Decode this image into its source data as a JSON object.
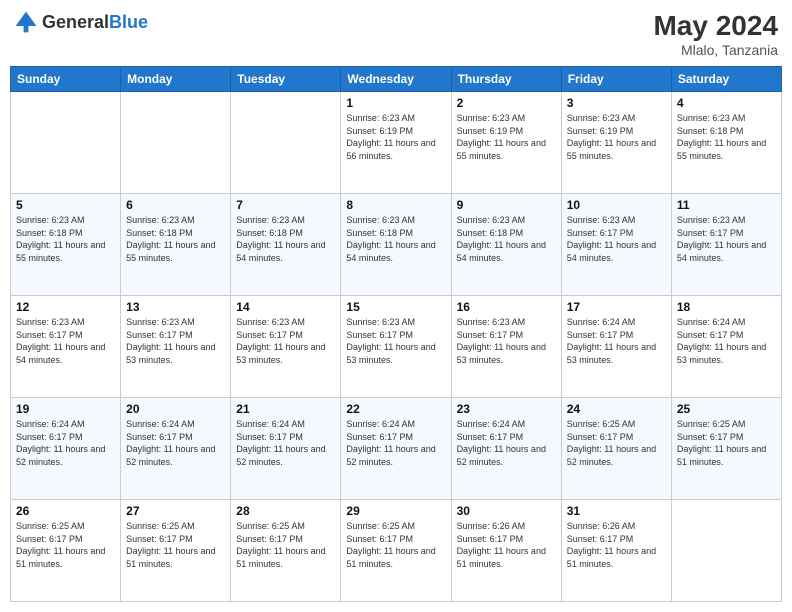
{
  "header": {
    "logo_general": "General",
    "logo_blue": "Blue",
    "month_year": "May 2024",
    "location": "Mlalo, Tanzania"
  },
  "days_of_week": [
    "Sunday",
    "Monday",
    "Tuesday",
    "Wednesday",
    "Thursday",
    "Friday",
    "Saturday"
  ],
  "weeks": [
    [
      {
        "day": "",
        "info": ""
      },
      {
        "day": "",
        "info": ""
      },
      {
        "day": "",
        "info": ""
      },
      {
        "day": "1",
        "info": "Sunrise: 6:23 AM\nSunset: 6:19 PM\nDaylight: 11 hours and 56 minutes."
      },
      {
        "day": "2",
        "info": "Sunrise: 6:23 AM\nSunset: 6:19 PM\nDaylight: 11 hours and 55 minutes."
      },
      {
        "day": "3",
        "info": "Sunrise: 6:23 AM\nSunset: 6:19 PM\nDaylight: 11 hours and 55 minutes."
      },
      {
        "day": "4",
        "info": "Sunrise: 6:23 AM\nSunset: 6:18 PM\nDaylight: 11 hours and 55 minutes."
      }
    ],
    [
      {
        "day": "5",
        "info": "Sunrise: 6:23 AM\nSunset: 6:18 PM\nDaylight: 11 hours and 55 minutes."
      },
      {
        "day": "6",
        "info": "Sunrise: 6:23 AM\nSunset: 6:18 PM\nDaylight: 11 hours and 55 minutes."
      },
      {
        "day": "7",
        "info": "Sunrise: 6:23 AM\nSunset: 6:18 PM\nDaylight: 11 hours and 54 minutes."
      },
      {
        "day": "8",
        "info": "Sunrise: 6:23 AM\nSunset: 6:18 PM\nDaylight: 11 hours and 54 minutes."
      },
      {
        "day": "9",
        "info": "Sunrise: 6:23 AM\nSunset: 6:18 PM\nDaylight: 11 hours and 54 minutes."
      },
      {
        "day": "10",
        "info": "Sunrise: 6:23 AM\nSunset: 6:17 PM\nDaylight: 11 hours and 54 minutes."
      },
      {
        "day": "11",
        "info": "Sunrise: 6:23 AM\nSunset: 6:17 PM\nDaylight: 11 hours and 54 minutes."
      }
    ],
    [
      {
        "day": "12",
        "info": "Sunrise: 6:23 AM\nSunset: 6:17 PM\nDaylight: 11 hours and 54 minutes."
      },
      {
        "day": "13",
        "info": "Sunrise: 6:23 AM\nSunset: 6:17 PM\nDaylight: 11 hours and 53 minutes."
      },
      {
        "day": "14",
        "info": "Sunrise: 6:23 AM\nSunset: 6:17 PM\nDaylight: 11 hours and 53 minutes."
      },
      {
        "day": "15",
        "info": "Sunrise: 6:23 AM\nSunset: 6:17 PM\nDaylight: 11 hours and 53 minutes."
      },
      {
        "day": "16",
        "info": "Sunrise: 6:23 AM\nSunset: 6:17 PM\nDaylight: 11 hours and 53 minutes."
      },
      {
        "day": "17",
        "info": "Sunrise: 6:24 AM\nSunset: 6:17 PM\nDaylight: 11 hours and 53 minutes."
      },
      {
        "day": "18",
        "info": "Sunrise: 6:24 AM\nSunset: 6:17 PM\nDaylight: 11 hours and 53 minutes."
      }
    ],
    [
      {
        "day": "19",
        "info": "Sunrise: 6:24 AM\nSunset: 6:17 PM\nDaylight: 11 hours and 52 minutes."
      },
      {
        "day": "20",
        "info": "Sunrise: 6:24 AM\nSunset: 6:17 PM\nDaylight: 11 hours and 52 minutes."
      },
      {
        "day": "21",
        "info": "Sunrise: 6:24 AM\nSunset: 6:17 PM\nDaylight: 11 hours and 52 minutes."
      },
      {
        "day": "22",
        "info": "Sunrise: 6:24 AM\nSunset: 6:17 PM\nDaylight: 11 hours and 52 minutes."
      },
      {
        "day": "23",
        "info": "Sunrise: 6:24 AM\nSunset: 6:17 PM\nDaylight: 11 hours and 52 minutes."
      },
      {
        "day": "24",
        "info": "Sunrise: 6:25 AM\nSunset: 6:17 PM\nDaylight: 11 hours and 52 minutes."
      },
      {
        "day": "25",
        "info": "Sunrise: 6:25 AM\nSunset: 6:17 PM\nDaylight: 11 hours and 51 minutes."
      }
    ],
    [
      {
        "day": "26",
        "info": "Sunrise: 6:25 AM\nSunset: 6:17 PM\nDaylight: 11 hours and 51 minutes."
      },
      {
        "day": "27",
        "info": "Sunrise: 6:25 AM\nSunset: 6:17 PM\nDaylight: 11 hours and 51 minutes."
      },
      {
        "day": "28",
        "info": "Sunrise: 6:25 AM\nSunset: 6:17 PM\nDaylight: 11 hours and 51 minutes."
      },
      {
        "day": "29",
        "info": "Sunrise: 6:25 AM\nSunset: 6:17 PM\nDaylight: 11 hours and 51 minutes."
      },
      {
        "day": "30",
        "info": "Sunrise: 6:26 AM\nSunset: 6:17 PM\nDaylight: 11 hours and 51 minutes."
      },
      {
        "day": "31",
        "info": "Sunrise: 6:26 AM\nSunset: 6:17 PM\nDaylight: 11 hours and 51 minutes."
      },
      {
        "day": "",
        "info": ""
      }
    ]
  ]
}
